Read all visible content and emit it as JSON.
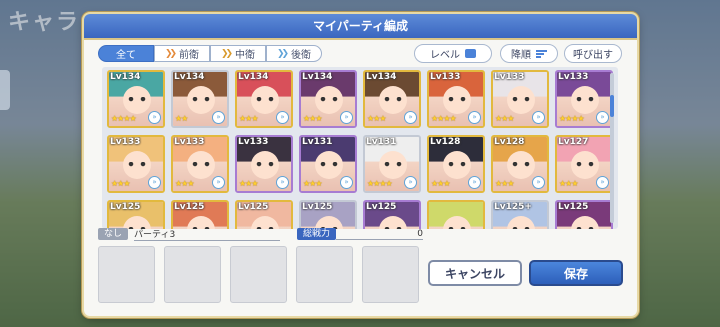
{
  "background": {
    "title_fragment": "キャラ"
  },
  "modal": {
    "title": "マイパーティ編成"
  },
  "filters": [
    {
      "label": "全て",
      "icon": ""
    },
    {
      "label": "前衛",
      "icon": "front-role-icon"
    },
    {
      "label": "中衛",
      "icon": "middle-role-icon"
    },
    {
      "label": "後衛",
      "icon": "back-role-icon"
    }
  ],
  "sort": {
    "level": "レベル",
    "order": "降順",
    "direction": "呼び出す"
  },
  "roster": [
    {
      "level": "Lv134",
      "stars": "★★★★",
      "frame": "gold",
      "hair": "#4aa7a3"
    },
    {
      "level": "Lv134",
      "stars": "★★",
      "frame": "silver",
      "hair": "#8b5a3a"
    },
    {
      "level": "Lv134",
      "stars": "★★★",
      "frame": "gold",
      "hair": "#d8505a"
    },
    {
      "level": "Lv134",
      "stars": "★★★",
      "frame": "purple",
      "hair": "#6a3a6c"
    },
    {
      "level": "Lv134",
      "stars": "★★★",
      "frame": "gold",
      "hair": "#6b4a32"
    },
    {
      "level": "Lv133",
      "stars": "★★★★",
      "frame": "gold",
      "hair": "#d9643c"
    },
    {
      "level": "Lv133",
      "stars": "★★★",
      "frame": "gold",
      "hair": "#e8e4e8"
    },
    {
      "level": "Lv133",
      "stars": "★★★★",
      "frame": "purple",
      "hair": "#7a4a98"
    },
    {
      "level": "Lv133",
      "stars": "★★★",
      "frame": "gold",
      "hair": "#f0c27a"
    },
    {
      "level": "Lv133",
      "stars": "★★★",
      "frame": "gold",
      "hair": "#f4b080"
    },
    {
      "level": "Lv133",
      "stars": "★★★",
      "frame": "purple",
      "hair": "#3a3240"
    },
    {
      "level": "Lv131",
      "stars": "★★★",
      "frame": "purple",
      "hair": "#4b3b70"
    },
    {
      "level": "Lv131",
      "stars": "★★★★",
      "frame": "silver",
      "hair": "#eeeeee"
    },
    {
      "level": "Lv128",
      "stars": "★★★",
      "frame": "gold",
      "hair": "#2d2d3a"
    },
    {
      "level": "Lv128",
      "stars": "★★★",
      "frame": "gold",
      "hair": "#e6a54a"
    },
    {
      "level": "Lv127",
      "stars": "★★★",
      "frame": "gold",
      "hair": "#f2a3b3"
    },
    {
      "level": "Lv125",
      "stars": "",
      "frame": "gold",
      "hair": "#e9c06a"
    },
    {
      "level": "Lv125",
      "stars": "",
      "frame": "gold",
      "hair": "#e07a56"
    },
    {
      "level": "Lv125",
      "stars": "",
      "frame": "gold",
      "hair": "#f0b8a0"
    },
    {
      "level": "Lv125",
      "stars": "",
      "frame": "silver",
      "hair": "#a8a2c4"
    },
    {
      "level": "Lv125",
      "stars": "",
      "frame": "purple",
      "hair": "#6a4a8a"
    },
    {
      "level": "",
      "stars": "",
      "frame": "gold",
      "hair": "#cfd96a"
    },
    {
      "level": "Lv125+",
      "stars": "",
      "frame": "silver",
      "hair": "#b0c4e4"
    },
    {
      "level": "Lv125",
      "stars": "",
      "frame": "purple",
      "hair": "#7a3a7a"
    }
  ],
  "party": {
    "tag": "なし",
    "name": "パーティ3"
  },
  "power": {
    "label": "総戦力",
    "value": "0"
  },
  "actions": {
    "cancel": "キャンセル",
    "save": "保存"
  },
  "colors": {
    "header_blue": "#3a66bf",
    "gold_frame": "#e2b93e"
  }
}
